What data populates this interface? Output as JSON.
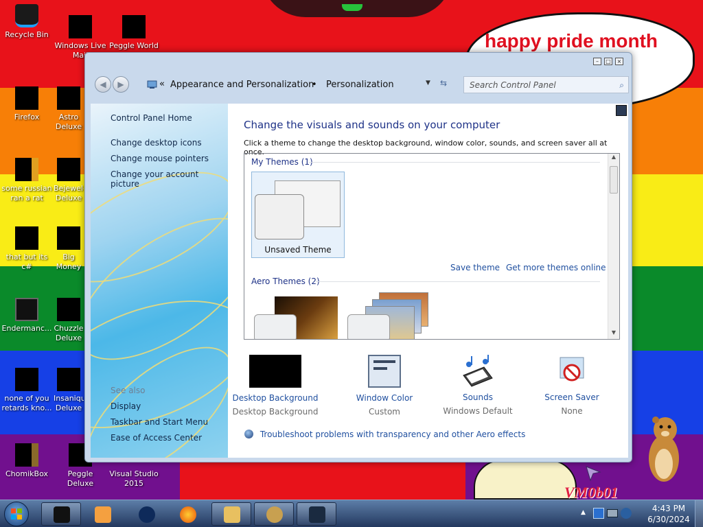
{
  "desktop": {
    "bubble_text": "happy pride month",
    "watermark": "VM0b01",
    "icons": [
      {
        "label": "Recycle Bin"
      },
      {
        "label": "Windows Live Mail"
      },
      {
        "label": "Peggle World"
      },
      {
        "label": "Firefox"
      },
      {
        "label": "Astro Deluxe"
      },
      {
        "label": "some russian ran a rat"
      },
      {
        "label": "Bejeweled Deluxe"
      },
      {
        "label": "that but its c#"
      },
      {
        "label": "Big Money Deluxe"
      },
      {
        "label": "Endermanc..."
      },
      {
        "label": "Chuzzle Deluxe"
      },
      {
        "label": "none of you retards kno..."
      },
      {
        "label": "Insaniquarium Deluxe"
      },
      {
        "label": "ChomikBox"
      },
      {
        "label": "Peggle Deluxe"
      },
      {
        "label": "Visual Studio 2015"
      }
    ]
  },
  "window": {
    "breadcrumb": {
      "overflow": "«",
      "item1": "Appearance and Personalization",
      "separator": "•",
      "item2": "Personalization"
    },
    "search_placeholder": "Search Control Panel",
    "left_pane": {
      "home": "Control Panel Home",
      "links": [
        "Change desktop icons",
        "Change mouse pointers",
        "Change your account picture"
      ],
      "see_also": "See also",
      "see_also_links": [
        "Display",
        "Taskbar and Start Menu",
        "Ease of Access Center"
      ]
    },
    "content": {
      "title": "Change the visuals and sounds on your computer",
      "subtitle": "Click a theme to change the desktop background, window color, sounds, and screen saver all at once.",
      "my_themes_header": "My Themes (1)",
      "unsaved_theme": "Unsaved Theme",
      "save_theme": "Save theme",
      "get_more": "Get more themes online",
      "aero_header": "Aero Themes (2)",
      "options": [
        {
          "name": "Desktop Background",
          "value": "Desktop Background"
        },
        {
          "name": "Window Color",
          "value": "Custom"
        },
        {
          "name": "Sounds",
          "value": "Windows Default"
        },
        {
          "name": "Screen Saver",
          "value": "None"
        }
      ],
      "troubleshoot": "Troubleshoot problems with transparency and other Aero effects"
    }
  },
  "taskbar": {
    "time": "4:43 PM",
    "date": "6/30/2024"
  }
}
